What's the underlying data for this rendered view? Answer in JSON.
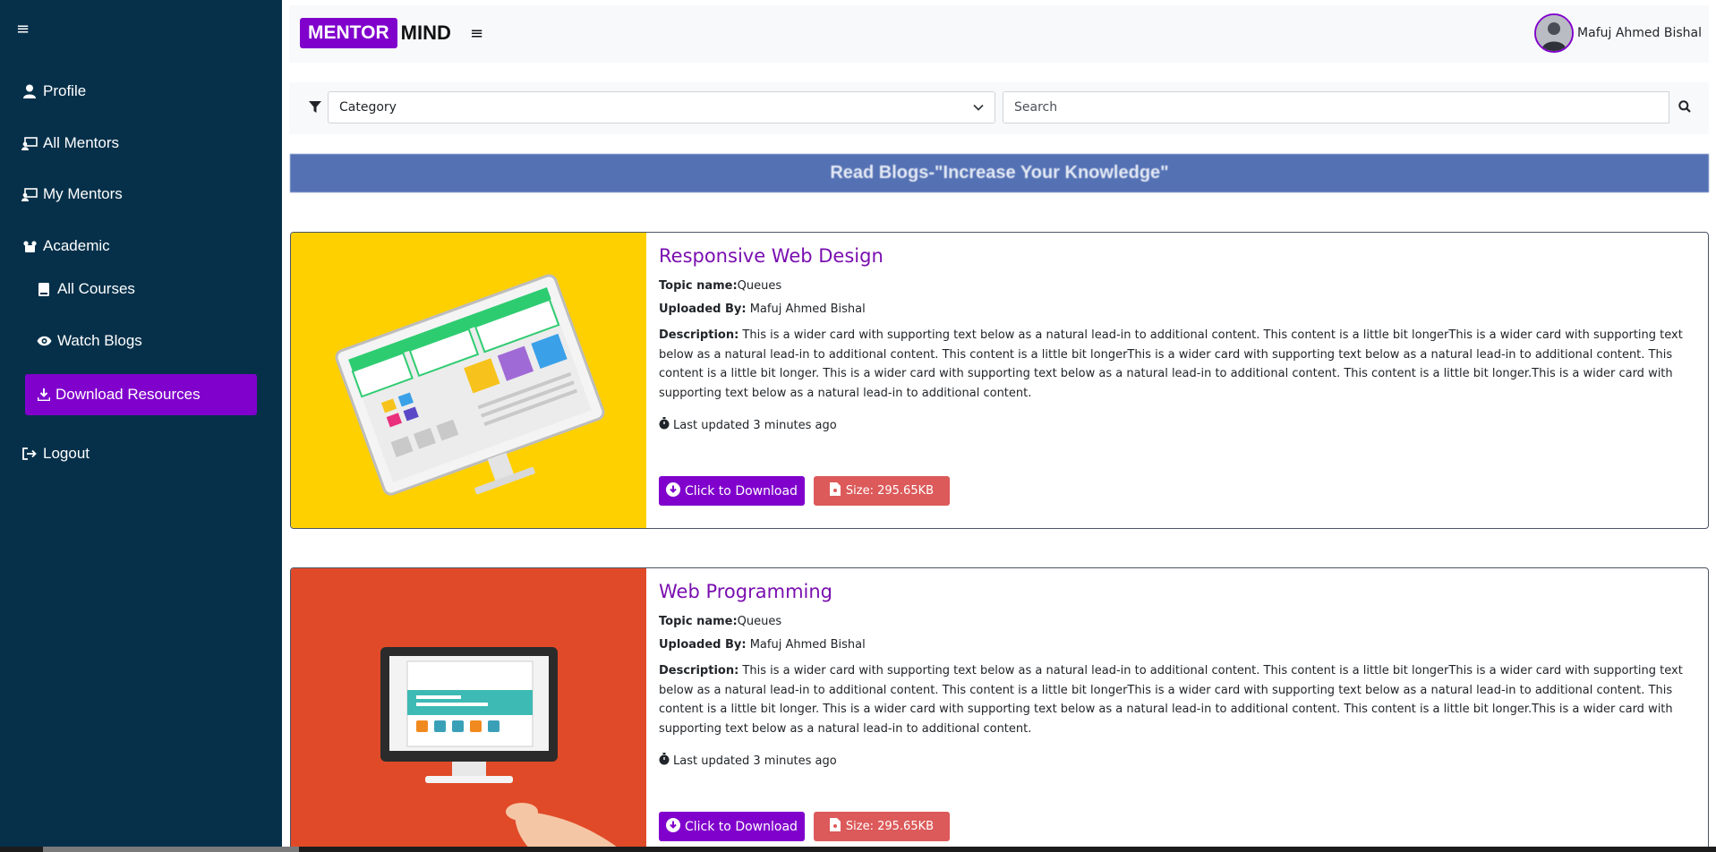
{
  "sidebar": {
    "items": [
      {
        "label": "Profile",
        "icon": "user-icon"
      },
      {
        "label": "All Mentors",
        "icon": "chalkboard-teacher-icon"
      },
      {
        "label": "My Mentors",
        "icon": "chalkboard-teacher-icon"
      },
      {
        "label": "Academic",
        "icon": "users-icon"
      },
      {
        "label": "All Courses",
        "icon": "book-icon"
      },
      {
        "label": "Watch Blogs",
        "icon": "eye-icon"
      },
      {
        "label": "Download Resources",
        "icon": "download-icon"
      },
      {
        "label": "Logout",
        "icon": "sign-out-icon"
      }
    ],
    "active": "Download Resources"
  },
  "header": {
    "logo_left": "MENTOR",
    "logo_right": "MIND",
    "user_name": "Mafuj Ahmed Bishal"
  },
  "filters": {
    "category": "Category",
    "search_placeholder": "Search"
  },
  "banner": "Read Blogs-\"Increase Your Knowledge\"",
  "cards": [
    {
      "title": "Responsive Web Design",
      "topic_label": "Topic name:",
      "topic": "Queues",
      "uploaded_label": "Uploaded By:",
      "uploaded_by": "Mafuj Ahmed Bishal",
      "desc_label": "Description:",
      "description": "This is a wider card with supporting text below as a natural lead-in to additional content. This content is a little bit longerThis is a wider card with supporting text below as a natural lead-in to additional content. This content is a little bit longerThis is a wider card with supporting text below as a natural lead-in to additional content. This content is a little bit longer. This is a wider card with supporting text below as a natural lead-in to additional content. This content is a little bit longer.This is a wider card with supporting text below as a natural lead-in to additional content.",
      "updated": "Last updated 3 minutes ago",
      "download_label": "Click to Download",
      "size_label": "Size: 295.65KB",
      "thumb_color": "#ffd000"
    },
    {
      "title": "Web Programming",
      "topic_label": "Topic name:",
      "topic": "Queues",
      "uploaded_label": "Uploaded By:",
      "uploaded_by": "Mafuj Ahmed Bishal",
      "desc_label": "Description:",
      "description": "This is a wider card with supporting text below as a natural lead-in to additional content. This content is a little bit longerThis is a wider card with supporting text below as a natural lead-in to additional content. This content is a little bit longerThis is a wider card with supporting text below as a natural lead-in to additional content. This content is a little bit longer. This is a wider card with supporting text below as a natural lead-in to additional content. This content is a little bit longer.This is a wider card with supporting text below as a natural lead-in to additional content.",
      "updated": "Last updated 3 minutes ago",
      "download_label": "Click to Download",
      "size_label": "Size: 295.65KB",
      "thumb_color": "#e04a28"
    }
  ],
  "colors": {
    "sidebar_bg": "#06304a",
    "accent": "#8000cc",
    "banner_bg": "#5471b4",
    "size_btn": "#dc5a5a"
  }
}
